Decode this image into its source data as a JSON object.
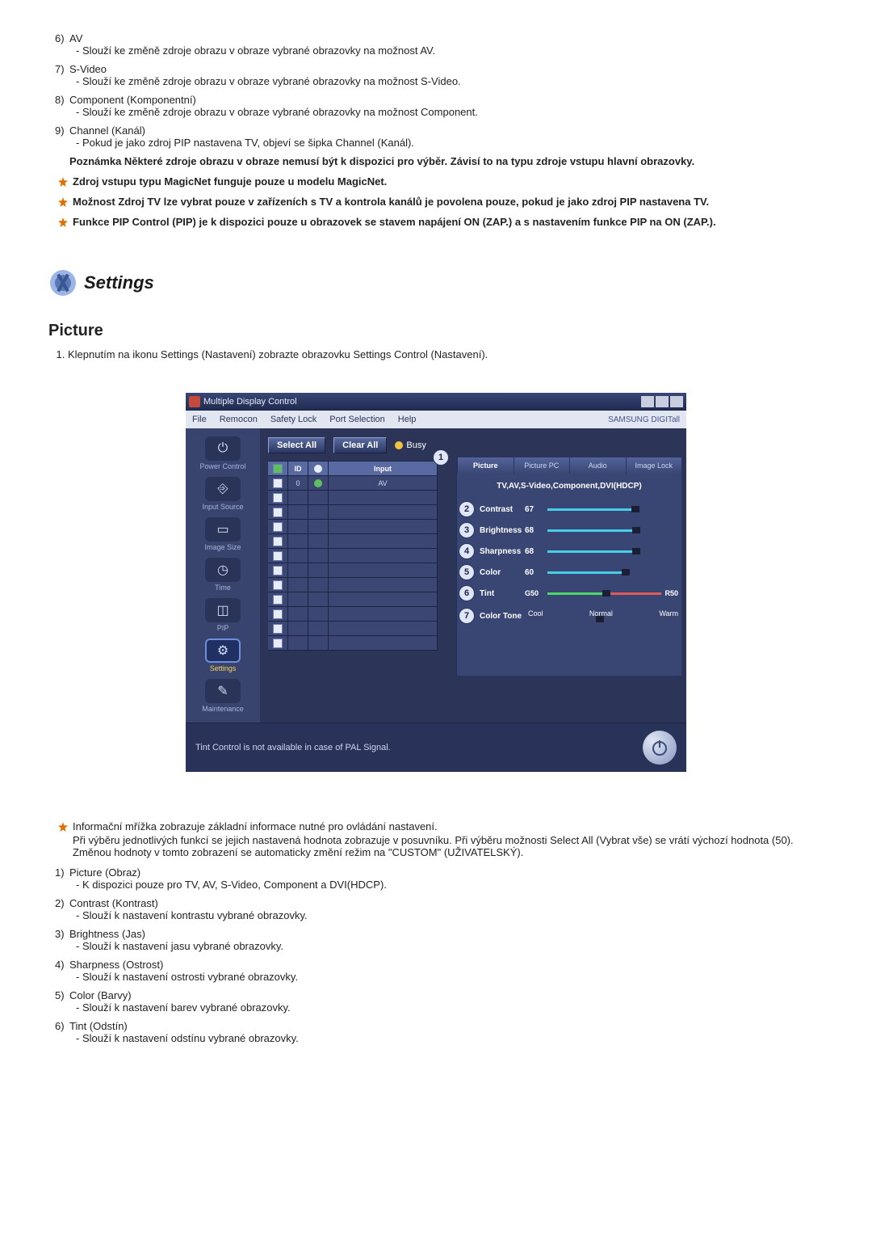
{
  "top_items": [
    {
      "num": "6)",
      "label": "AV",
      "desc": "- Slouží ke změně zdroje obrazu v obraze vybrané obrazovky na možnost AV."
    },
    {
      "num": "7)",
      "label": "S-Video",
      "desc": "- Slouží ke změně zdroje obrazu v obraze vybrané obrazovky na možnost S-Video."
    },
    {
      "num": "8)",
      "label": "Component (Komponentní)",
      "desc": "- Slouží ke změně zdroje obrazu v obraze vybrané obrazovky na možnost Component."
    },
    {
      "num": "9)",
      "label": "Channel (Kanál)",
      "desc": "- Pokud je jako zdroj PIP nastavena TV, objeví se šipka Channel (Kanál)."
    }
  ],
  "note_bold": "Poznámka Některé zdroje obrazu v obraze nemusí být k dispozici pro výběr. Závisí to na typu zdroje vstupu hlavní obrazovky.",
  "stars": [
    "Zdroj vstupu typu MagicNet funguje pouze u modelu MagicNet.",
    "Možnost Zdroj TV lze vybrat pouze v zařízeních s TV a kontrola kanálů je povolena pouze, pokud je jako zdroj PIP nastavena TV.",
    "Funkce PIP Control (PIP) je k dispozici pouze u obrazovek se stavem napájení ON (ZAP.) a s nastavením funkce PIP na ON (ZAP.)."
  ],
  "settings_title": "Settings",
  "picture_title": "Picture",
  "picture_step": "Klepnutím na ikonu Settings (Nastavení) zobrazte obrazovku Settings Control (Nastavení).",
  "app": {
    "title": "Multiple Display Control",
    "menus": [
      "File",
      "Remocon",
      "Safety Lock",
      "Port Selection",
      "Help"
    ],
    "brand": "SAMSUNG DIGITall",
    "sidebar": [
      {
        "label": "Power Control"
      },
      {
        "label": "Input Source"
      },
      {
        "label": "Image Size"
      },
      {
        "label": "Time"
      },
      {
        "label": "PIP"
      },
      {
        "label": "Settings",
        "selected": true
      },
      {
        "label": "Maintenance"
      }
    ],
    "select_all": "Select All",
    "clear_all": "Clear All",
    "busy": "Busy",
    "grid_head": [
      "",
      "ID",
      "",
      "Input"
    ],
    "grid_row1": {
      "id": "0",
      "input": "AV"
    },
    "tabs": [
      "Picture",
      "Picture PC",
      "Audio",
      "Image Lock"
    ],
    "source_line": "TV,AV,S-Video,Component,DVI(HDCP)",
    "sliders": [
      {
        "n": "2",
        "label": "Contrast",
        "val": "67"
      },
      {
        "n": "3",
        "label": "Brightness",
        "val": "68"
      },
      {
        "n": "4",
        "label": "Sharpness",
        "val": "68"
      },
      {
        "n": "5",
        "label": "Color",
        "val": "60"
      }
    ],
    "tint": {
      "n": "6",
      "label": "Tint",
      "left": "G50",
      "right": "R50"
    },
    "ctone": {
      "n": "7",
      "label": "Color Tone",
      "opts": [
        "Cool",
        "Normal",
        "Warm"
      ]
    },
    "foot": "Tint Control is not available in case of PAL Signal."
  },
  "info_star": "Informační mřížka zobrazuje základní informace nutné pro ovládání nastavení.",
  "info_para": "Při výběru jednotlivých funkcí se jejich nastavená hodnota zobrazuje v posuvníku. Při výběru možnosti Select All (Vybrat vše) se vrátí výchozí hodnota (50). Změnou hodnoty v tomto zobrazení se automaticky změní režim na \"CUSTOM\" (UŽIVATELSKÝ).",
  "bottom_items": [
    {
      "num": "1)",
      "label": "Picture (Obraz)",
      "desc": "- K dispozici pouze pro TV, AV, S-Video, Component a DVI(HDCP)."
    },
    {
      "num": "2)",
      "label": "Contrast (Kontrast)",
      "desc": "- Slouží k nastavení kontrastu vybrané obrazovky."
    },
    {
      "num": "3)",
      "label": "Brightness (Jas)",
      "desc": "- Slouží k nastavení jasu vybrané obrazovky."
    },
    {
      "num": "4)",
      "label": "Sharpness (Ostrost)",
      "desc": "- Slouží k nastavení ostrosti vybrané obrazovky."
    },
    {
      "num": "5)",
      "label": "Color (Barvy)",
      "desc": "- Slouží k nastavení barev vybrané obrazovky."
    },
    {
      "num": "6)",
      "label": "Tint (Odstín)",
      "desc": "- Slouží k nastavení odstínu vybrané obrazovky."
    }
  ]
}
